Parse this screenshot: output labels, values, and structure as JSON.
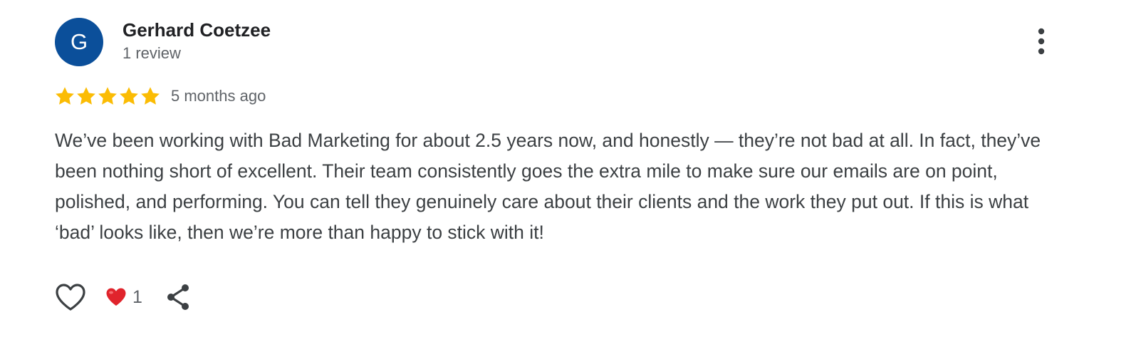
{
  "reviewer": {
    "initial": "G",
    "name": "Gerhard Coetzee",
    "review_count": "1 review",
    "avatar_color": "#0b4f9a"
  },
  "review": {
    "rating": 5,
    "max_rating": 5,
    "star_color": "#fbbc04",
    "date": "5 months ago",
    "text": "We’ve been working with Bad Marketing for about 2.5 years now, and honestly — they’re not bad at all. In fact, they’ve been nothing short of excellent. Their team consistently goes the extra mile to make sure our emails are on point, polished, and performing. You can tell they genuinely care about their clients and the work they put out. If this is what ‘bad’ looks like, then we’re more than happy to stick with it!"
  },
  "actions": {
    "like_icon": "heart-outline-icon",
    "reaction_icon": "red-heart-emoji-icon",
    "reaction_count": "1",
    "share_icon": "share-icon",
    "menu_icon": "more-vert-icon"
  }
}
